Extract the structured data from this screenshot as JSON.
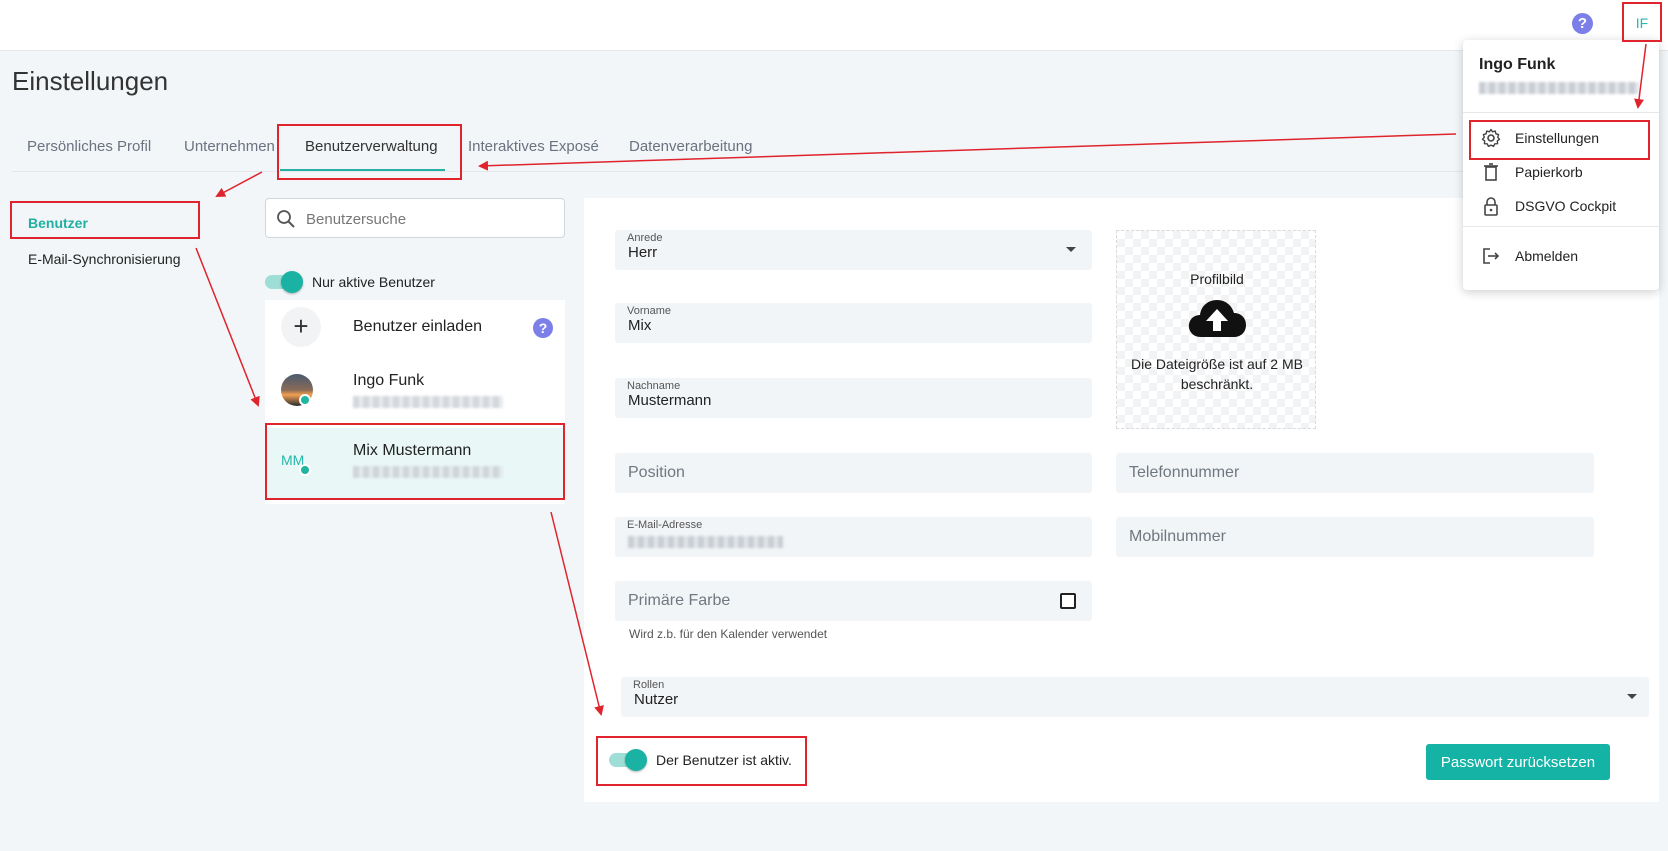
{
  "header": {
    "help_label": "?",
    "avatar_initials": "IF"
  },
  "page": {
    "title": "Einstellungen"
  },
  "tabs": [
    {
      "label": "Persönliches Profil"
    },
    {
      "label": "Unternehmen"
    },
    {
      "label": "Benutzerverwaltung"
    },
    {
      "label": "Interaktives Exposé"
    },
    {
      "label": "Datenverarbeitung"
    }
  ],
  "subnav": [
    {
      "label": "Benutzer"
    },
    {
      "label": "E-Mail-Synchronisierung"
    }
  ],
  "users_panel": {
    "search_placeholder": "Benutzersuche",
    "active_filter_label": "Nur aktive Benutzer",
    "invite_label": "Benutzer einladen",
    "invite_icon": "+",
    "help_label": "?",
    "users": [
      {
        "name": "Ingo Funk",
        "initials": ""
      },
      {
        "name": "Mix Mustermann",
        "initials": "MM"
      }
    ]
  },
  "form": {
    "salutation": {
      "label": "Anrede",
      "value": "Herr"
    },
    "first_name": {
      "label": "Vorname",
      "value": "Mix"
    },
    "last_name": {
      "label": "Nachname",
      "value": "Mustermann"
    },
    "position_placeholder": "Position",
    "phone_placeholder": "Telefonnummer",
    "email": {
      "label": "E-Mail-Adresse"
    },
    "mobile_placeholder": "Mobilnummer",
    "color": {
      "placeholder": "Primäre Farbe",
      "hint": "Wird z.b. für den Kalender verwendet"
    },
    "roles": {
      "label": "Rollen",
      "value": "Nutzer"
    },
    "active_label": "Der Benutzer ist aktiv.",
    "reset_password_label": "Passwort zurücksetzen",
    "profile_picture": {
      "title": "Profilbild",
      "hint": "Die Dateigröße ist auf 2 MB beschränkt."
    }
  },
  "user_menu": {
    "name": "Ingo Funk",
    "items": [
      {
        "label": "Einstellungen",
        "icon": "gear-icon"
      },
      {
        "label": "Papierkorb",
        "icon": "trash-icon"
      },
      {
        "label": "DSGVO Cockpit",
        "icon": "lock-icon"
      },
      {
        "label": "Abmelden",
        "icon": "logout-icon"
      }
    ]
  },
  "colors": {
    "accent": "#14b3a5",
    "highlight": "#e0242d",
    "help": "#7c7fe8"
  }
}
